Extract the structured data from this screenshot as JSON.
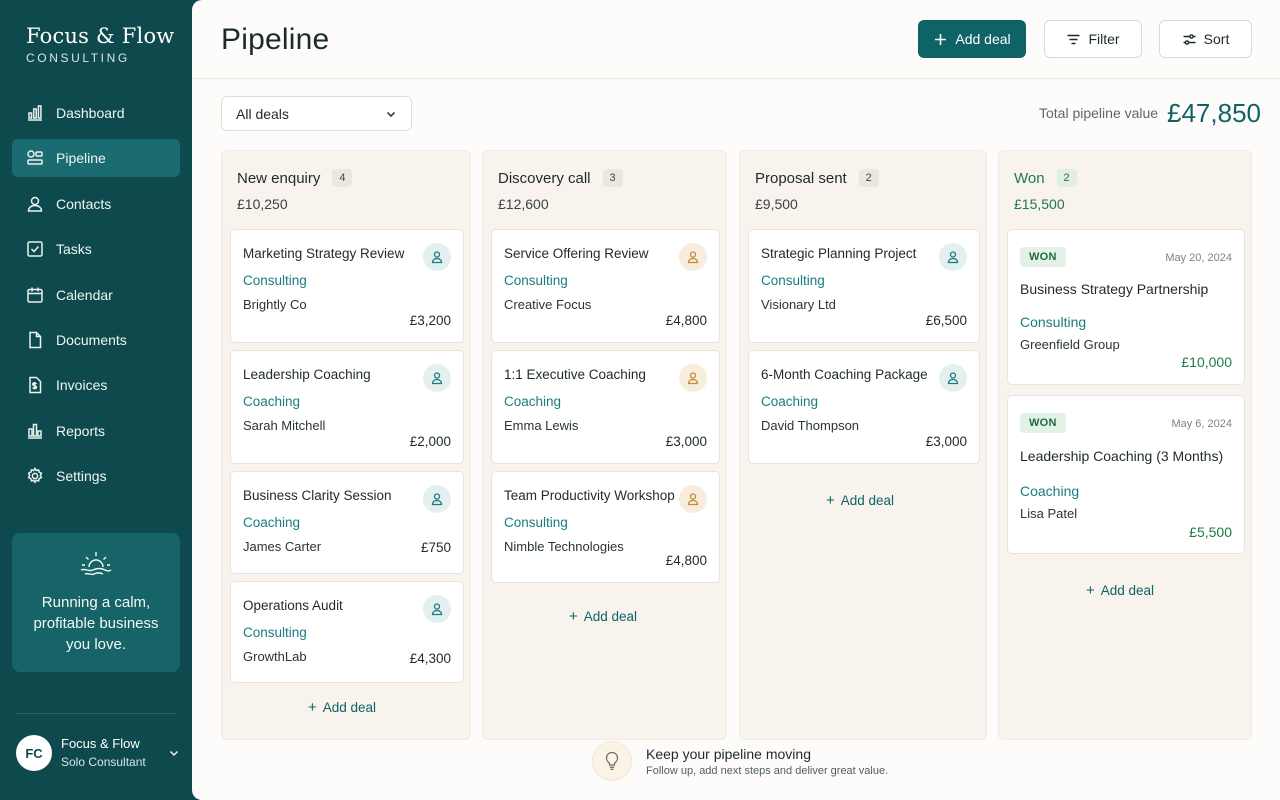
{
  "brand": {
    "name": "Focus & Flow",
    "sub": "CONSULTING"
  },
  "sidebar": {
    "items": [
      {
        "label": "Dashboard",
        "icon": "dashboard-icon"
      },
      {
        "label": "Pipeline",
        "icon": "pipeline-icon",
        "active": true
      },
      {
        "label": "Contacts",
        "icon": "contacts-icon"
      },
      {
        "label": "Tasks",
        "icon": "tasks-icon"
      },
      {
        "label": "Calendar",
        "icon": "calendar-icon"
      },
      {
        "label": "Documents",
        "icon": "documents-icon"
      },
      {
        "label": "Invoices",
        "icon": "invoices-icon"
      },
      {
        "label": "Reports",
        "icon": "reports-icon"
      },
      {
        "label": "Settings",
        "icon": "settings-icon"
      }
    ],
    "promo": {
      "text": "Running a calm, profitable business you love.",
      "icon": "sunrise-icon"
    },
    "user": {
      "initials": "FC",
      "name": "Focus & Flow",
      "role": "Solo Consultant"
    }
  },
  "header": {
    "title": "Pipeline",
    "add_deal_label": "Add deal",
    "filter_label": "Filter",
    "sort_label": "Sort"
  },
  "toolbar": {
    "filter_select": "All deals",
    "total_label": "Total pipeline value",
    "total_value": "£47,850"
  },
  "columns": [
    {
      "title": "New enquiry",
      "count": "4",
      "total": "£10,250",
      "cards": [
        {
          "title": "Marketing Strategy Review",
          "category": "Consulting",
          "client": "Brightly Co",
          "amount": "£3,200"
        },
        {
          "title": "Leadership Coaching",
          "category": "Coaching",
          "client": "Sarah Mitchell",
          "amount": "£2,000"
        },
        {
          "title": "Business Clarity Session",
          "category": "Coaching",
          "client": "James Carter",
          "amount": "£750"
        },
        {
          "title": "Operations Audit",
          "category": "Consulting",
          "client": "GrowthLab",
          "amount": "£4,300"
        }
      ],
      "add_label": "Add deal"
    },
    {
      "title": "Discovery call",
      "count": "3",
      "total": "£12,600",
      "cards": [
        {
          "title": "Service Offering Review",
          "category": "Consulting",
          "client": "Creative Focus",
          "amount": "£4,800"
        },
        {
          "title": "1:1 Executive Coaching",
          "category": "Coaching",
          "client": "Emma Lewis",
          "amount": "£3,000"
        },
        {
          "title": "Team Productivity Workshop",
          "category": "Consulting",
          "client": "Nimble Technologies",
          "amount": "£4,800"
        }
      ],
      "add_label": "Add deal"
    },
    {
      "title": "Proposal sent",
      "count": "2",
      "total": "£9,500",
      "cards": [
        {
          "title": "Strategic Planning Project",
          "category": "Consulting",
          "client": "Visionary Ltd",
          "amount": "£6,500"
        },
        {
          "title": "6-Month Coaching Package",
          "category": "Coaching",
          "client": "David Thompson",
          "amount": "£3,000"
        }
      ],
      "add_label": "Add deal"
    },
    {
      "title": "Won",
      "count": "2",
      "total": "£15,500",
      "cards": [
        {
          "badge": "WON",
          "date": "May 20, 2024",
          "title": "Business Strategy Partnership",
          "category": "Consulting",
          "client": "Greenfield Group",
          "amount": "£10,000"
        },
        {
          "badge": "WON",
          "date": "May 6, 2024",
          "title": "Leadership Coaching (3 Months)",
          "category": "Coaching",
          "client": "Lisa Patel",
          "amount": "£5,500"
        }
      ],
      "add_label": "Add deal"
    }
  ],
  "tip": {
    "title": "Keep your pipeline moving",
    "subtitle": "Follow up, add next steps and deliver great value.",
    "icon": "lightbulb-icon"
  },
  "colors": {
    "sidebar_bg": "#0e4a4d",
    "accent": "#0f6266",
    "won_green": "#1f7a46",
    "column_bg": "#f8f3ec"
  }
}
